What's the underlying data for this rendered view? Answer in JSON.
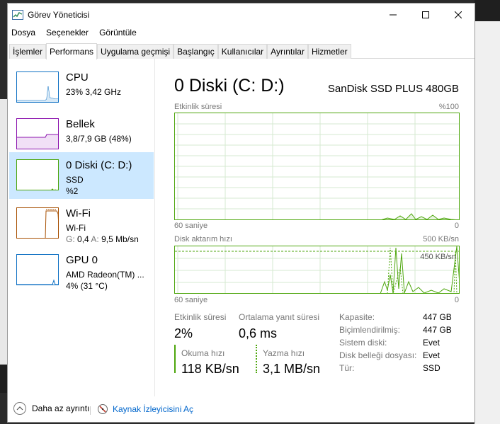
{
  "window": {
    "title": "Görev Yöneticisi"
  },
  "menu": [
    "Dosya",
    "Seçenekler",
    "Görüntüle"
  ],
  "tabs": [
    "İşlemler",
    "Performans",
    "Uygulama geçmişi",
    "Başlangıç",
    "Kullanıcılar",
    "Ayrıntılar",
    "Hizmetler"
  ],
  "active_tab": "Performans",
  "perf_items": [
    {
      "title": "CPU",
      "sub1": "23% 3,42 GHz",
      "sub2": "",
      "color": "#1172c4"
    },
    {
      "title": "Bellek",
      "sub1": "3,8/7,9 GB (48%)",
      "sub2": "",
      "color": "#8b12ae"
    },
    {
      "title": "0 Diski (C: D:)",
      "sub1": "SSD",
      "sub2": "%2",
      "color": "#4da60c"
    },
    {
      "title": "Wi-Fi",
      "sub1": "Wi-Fi",
      "sub2_g_label": "G:",
      "sub2_g": "0,4",
      "sub2_a_label": "A:",
      "sub2_a": "9,5 Mb/sn",
      "color": "#a74f01"
    },
    {
      "title": "GPU 0",
      "sub1": "AMD Radeon(TM) ...",
      "sub2": "4% (31 °C)",
      "color": "#1172c4"
    }
  ],
  "selected_item": "0 Diski (C: D:)",
  "detail": {
    "title": "0 Diski (C: D:)",
    "model": "SanDisk SSD PLUS 480GB",
    "graph1": {
      "label": "Etkinlik süresi",
      "max": "%100",
      "x_left": "60 saniye",
      "x_right": "0"
    },
    "graph2": {
      "label": "Disk aktarım hızı",
      "max": "500 KB/sn",
      "marker": "450 KB/sn",
      "x_left": "60 saniye",
      "x_right": "0"
    },
    "stats": {
      "active_label": "Etkinlik süresi",
      "active_value": "2%",
      "response_label": "Ortalama yanıt süresi",
      "response_value": "0,6 ms",
      "read_label": "Okuma hızı",
      "read_value": "118 KB/sn",
      "write_label": "Yazma hızı",
      "write_value": "3,1 MB/sn"
    },
    "properties": [
      {
        "label": "Kapasite:",
        "value": "447 GB"
      },
      {
        "label": "Biçimlendirilmiş:",
        "value": "447 GB"
      },
      {
        "label": "Sistem diski:",
        "value": "Evet"
      },
      {
        "label": "Disk belleği dosyası:",
        "value": "Evet"
      },
      {
        "label": "Tür:",
        "value": "SSD"
      }
    ]
  },
  "footer": {
    "fewer_details": "Daha az ayrıntı",
    "resource_monitor": "Kaynak İzleyicisini Aç"
  }
}
